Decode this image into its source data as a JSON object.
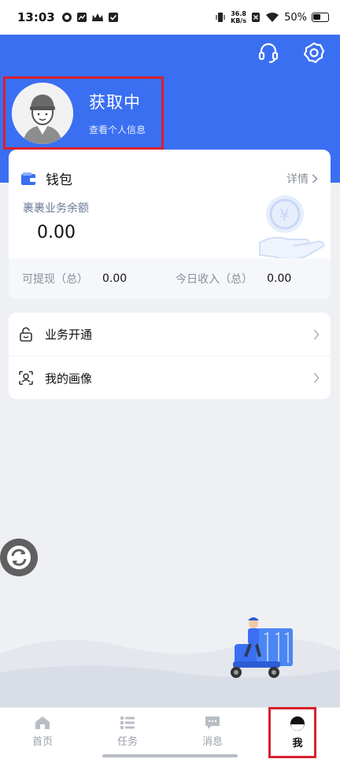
{
  "status_bar": {
    "time": "13:03",
    "net_speed_value": "36.8",
    "net_speed_unit": "KB/s",
    "battery": "50%"
  },
  "header": {
    "icons": [
      "headset-icon",
      "settings-icon"
    ]
  },
  "profile": {
    "name": "获取中",
    "subtitle": "查看个人信息"
  },
  "wallet": {
    "title": "钱包",
    "detail_label": "详情",
    "balance_label": "裹裹业务余额",
    "balance_value": "0.00",
    "withdrawable_label": "可提现（总）",
    "withdrawable_value": "0.00",
    "today_income_label": "今日收入（总）",
    "today_income_value": "0.00",
    "accent": "#3a6ff2"
  },
  "menu": {
    "items": [
      {
        "label": "业务开通",
        "icon": "lock-icon"
      },
      {
        "label": "我的画像",
        "icon": "face-scan-icon"
      }
    ]
  },
  "tabs": [
    {
      "label": "首页",
      "icon": "home-icon"
    },
    {
      "label": "任务",
      "icon": "task-list-icon"
    },
    {
      "label": "消息",
      "icon": "message-icon"
    },
    {
      "label": "我",
      "icon": "profile-icon",
      "active": true
    }
  ],
  "colors": {
    "brand_blue": "#3a6ff2",
    "highlight_red": "#d8202f"
  }
}
